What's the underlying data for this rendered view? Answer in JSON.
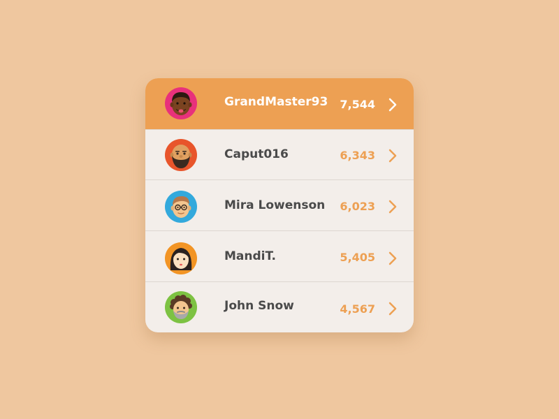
{
  "colors": {
    "background": "#efc79f",
    "card": "#f3eeea",
    "highlight": "#eda053",
    "name_text": "#4a4a4a",
    "score_text": "#eda053"
  },
  "leaderboard": [
    {
      "name": "GrandMaster93",
      "score": "7,544",
      "avatar_icon": "avatar-dark-skin-man-icon",
      "avatar_color": "#e8317b",
      "highlighted": true
    },
    {
      "name": "Caput016",
      "score": "6,343",
      "avatar_icon": "avatar-bald-bearded-man-icon",
      "avatar_color": "#e8552b",
      "highlighted": false
    },
    {
      "name": "Mira Lowenson",
      "score": "6,023",
      "avatar_icon": "avatar-glasses-man-icon",
      "avatar_color": "#33a9dc",
      "highlighted": false
    },
    {
      "name": "MandiT.",
      "score": "5,405",
      "avatar_icon": "avatar-dark-hair-woman-icon",
      "avatar_color": "#f29424",
      "highlighted": false
    },
    {
      "name": "John Snow",
      "score": "4,567",
      "avatar_icon": "avatar-curly-hair-man-icon",
      "avatar_color": "#7dc242",
      "highlighted": false
    }
  ]
}
